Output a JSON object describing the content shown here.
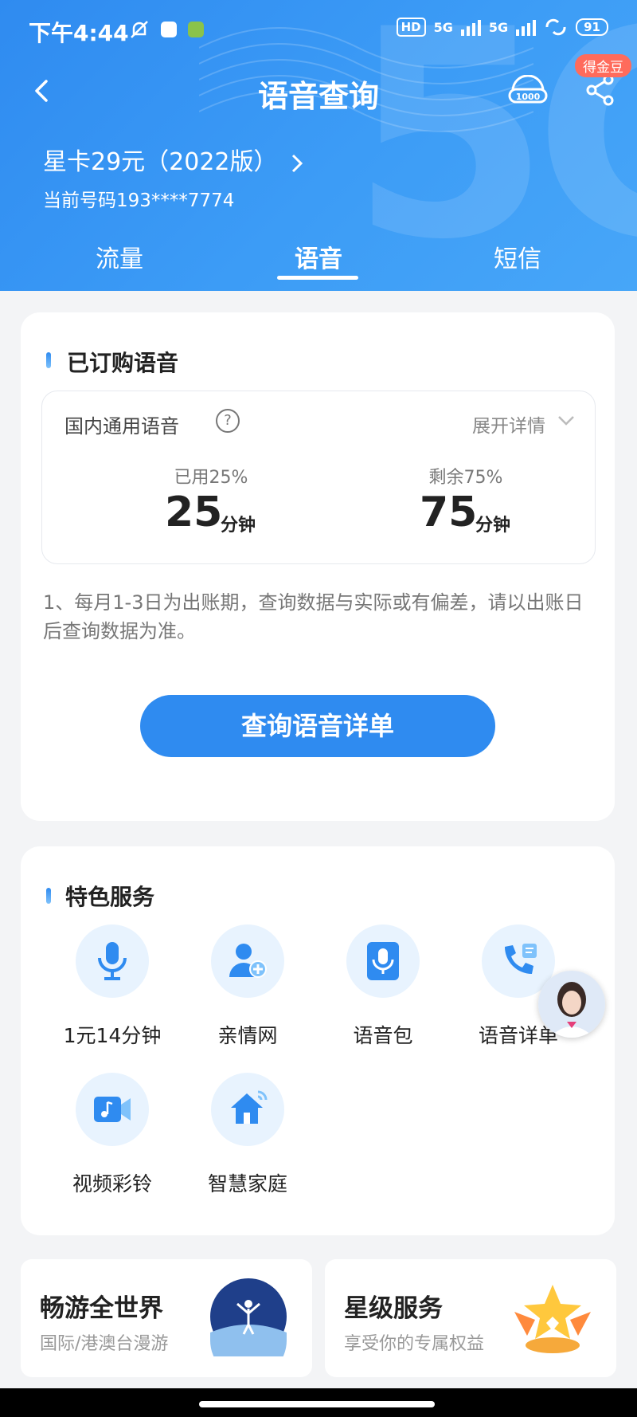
{
  "status_bar": {
    "time": "下午4:44",
    "hd": "HD",
    "net1": "5G",
    "net2": "5G",
    "battery": "91"
  },
  "nav": {
    "title": "语音查询",
    "badge": "得金豆",
    "service_icon": "10000-service-icon"
  },
  "plan": {
    "name": "星卡29元（2022版）",
    "phone": "当前号码193****7774"
  },
  "tabs": [
    {
      "label": "流量"
    },
    {
      "label": "语音"
    },
    {
      "label": "短信"
    }
  ],
  "active_tab": "语音",
  "subscribed": {
    "section_title": "已订购语音",
    "item_title": "国内通用语音",
    "help": "?",
    "expand_label": "展开详情",
    "used_label": "已用25%",
    "used_value": "25",
    "remaining_label": "剩余75%",
    "remaining_value": "75",
    "unit": "分钟",
    "note": "1、每月1-3日为出账期，查询数据与实际或有偏差，请以出账日后查询数据为准。",
    "query_button": "查询语音详单"
  },
  "features": {
    "section_title": "特色服务",
    "items": [
      {
        "label": "1元14分钟",
        "icon": "microphone-icon"
      },
      {
        "label": "亲情网",
        "icon": "add-member-icon"
      },
      {
        "label": "语音包",
        "icon": "voice-pack-icon"
      },
      {
        "label": "语音详单",
        "icon": "phone-list-icon"
      },
      {
        "label": "视频彩铃",
        "icon": "video-ringtone-icon"
      },
      {
        "label": "智慧家庭",
        "icon": "smart-home-icon"
      }
    ]
  },
  "promos": [
    {
      "title": "畅游全世界",
      "subtitle": "国际/港澳台漫游"
    },
    {
      "title": "星级服务",
      "subtitle": "享受你的专属权益"
    }
  ],
  "colors": {
    "primary": "#2f8bf0",
    "badge": "#ff6b5c",
    "icon_bg": "#e8f3fe"
  }
}
